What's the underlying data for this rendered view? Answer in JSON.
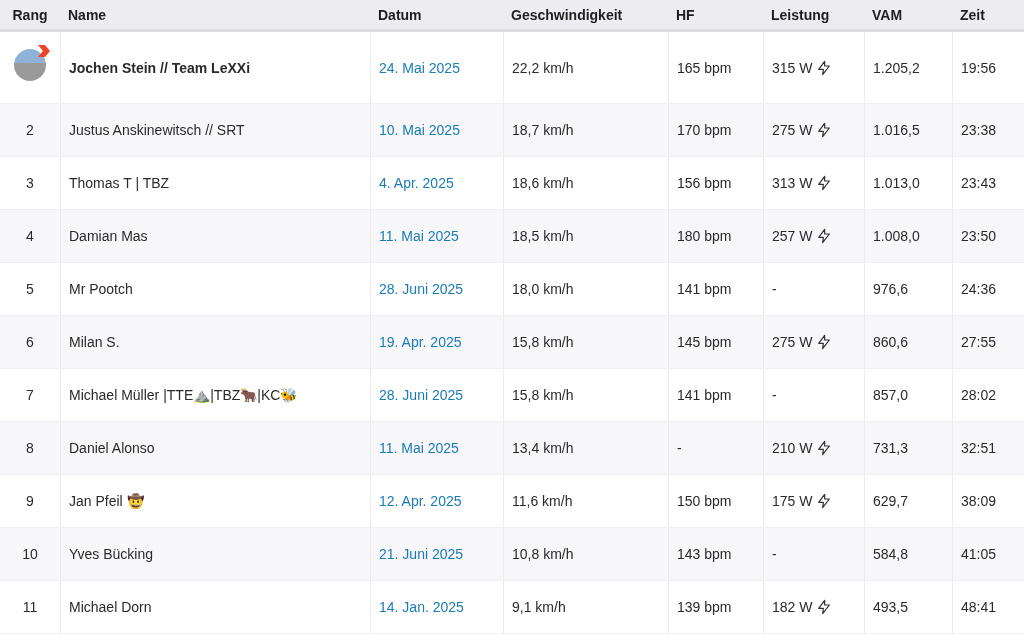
{
  "table": {
    "columns": [
      "Rang",
      "Name",
      "Datum",
      "Geschwindigkeit",
      "HF",
      "Leistung",
      "VAM",
      "Zeit"
    ],
    "rows": [
      {
        "rank": null,
        "current_user": true,
        "name": "Jochen Stein // Team LeXXi",
        "date": "24. Mai 2025",
        "speed": "22,2 km/h",
        "hr": "165 bpm",
        "power": "315 W",
        "power_icon": true,
        "vam": "1.205,2",
        "time": "19:56"
      },
      {
        "rank": "2",
        "current_user": false,
        "name": "Justus Anskinewitsch // SRT",
        "date": "10. Mai 2025",
        "speed": "18,7 km/h",
        "hr": "170 bpm",
        "power": "275 W",
        "power_icon": true,
        "vam": "1.016,5",
        "time": "23:38"
      },
      {
        "rank": "3",
        "current_user": false,
        "name": "Thomas T | TBZ",
        "date": "4. Apr. 2025",
        "speed": "18,6 km/h",
        "hr": "156 bpm",
        "power": "313 W",
        "power_icon": true,
        "vam": "1.013,0",
        "time": "23:43"
      },
      {
        "rank": "4",
        "current_user": false,
        "name": "Damian Mas",
        "date": "11. Mai 2025",
        "speed": "18,5 km/h",
        "hr": "180 bpm",
        "power": "257 W",
        "power_icon": true,
        "vam": "1.008,0",
        "time": "23:50"
      },
      {
        "rank": "5",
        "current_user": false,
        "name": "Mr Pootch",
        "date": "28. Juni 2025",
        "speed": "18,0 km/h",
        "hr": "141 bpm",
        "power": "-",
        "power_icon": false,
        "vam": "976,6",
        "time": "24:36"
      },
      {
        "rank": "6",
        "current_user": false,
        "name": "Milan S.",
        "date": "19. Apr. 2025",
        "speed": "15,8 km/h",
        "hr": "145 bpm",
        "power": "275 W",
        "power_icon": true,
        "vam": "860,6",
        "time": "27:55"
      },
      {
        "rank": "7",
        "current_user": false,
        "name": "Michael Müller |TTE⛰️|TBZ🐂|KC🐝",
        "date": "28. Juni 2025",
        "speed": "15,8 km/h",
        "hr": "141 bpm",
        "power": "-",
        "power_icon": false,
        "vam": "857,0",
        "time": "28:02"
      },
      {
        "rank": "8",
        "current_user": false,
        "name": "Daniel Alonso",
        "date": "11. Mai 2025",
        "speed": "13,4 km/h",
        "hr": "-",
        "power": "210 W",
        "power_icon": true,
        "vam": "731,3",
        "time": "32:51"
      },
      {
        "rank": "9",
        "current_user": false,
        "name": "Jan Pfeil 🤠",
        "date": "12. Apr. 2025",
        "speed": "11,6 km/h",
        "hr": "150 bpm",
        "power": "175 W",
        "power_icon": true,
        "vam": "629,7",
        "time": "38:09"
      },
      {
        "rank": "10",
        "current_user": false,
        "name": "Yves Bücking",
        "date": "21. Juni 2025",
        "speed": "10,8 km/h",
        "hr": "143 bpm",
        "power": "-",
        "power_icon": false,
        "vam": "584,8",
        "time": "41:05"
      },
      {
        "rank": "11",
        "current_user": false,
        "name": "Michael Dorn",
        "date": "14. Jan. 2025",
        "speed": "9,1 km/h",
        "hr": "139 bpm",
        "power": "182 W",
        "power_icon": true,
        "vam": "493,5",
        "time": "48:41"
      }
    ]
  }
}
